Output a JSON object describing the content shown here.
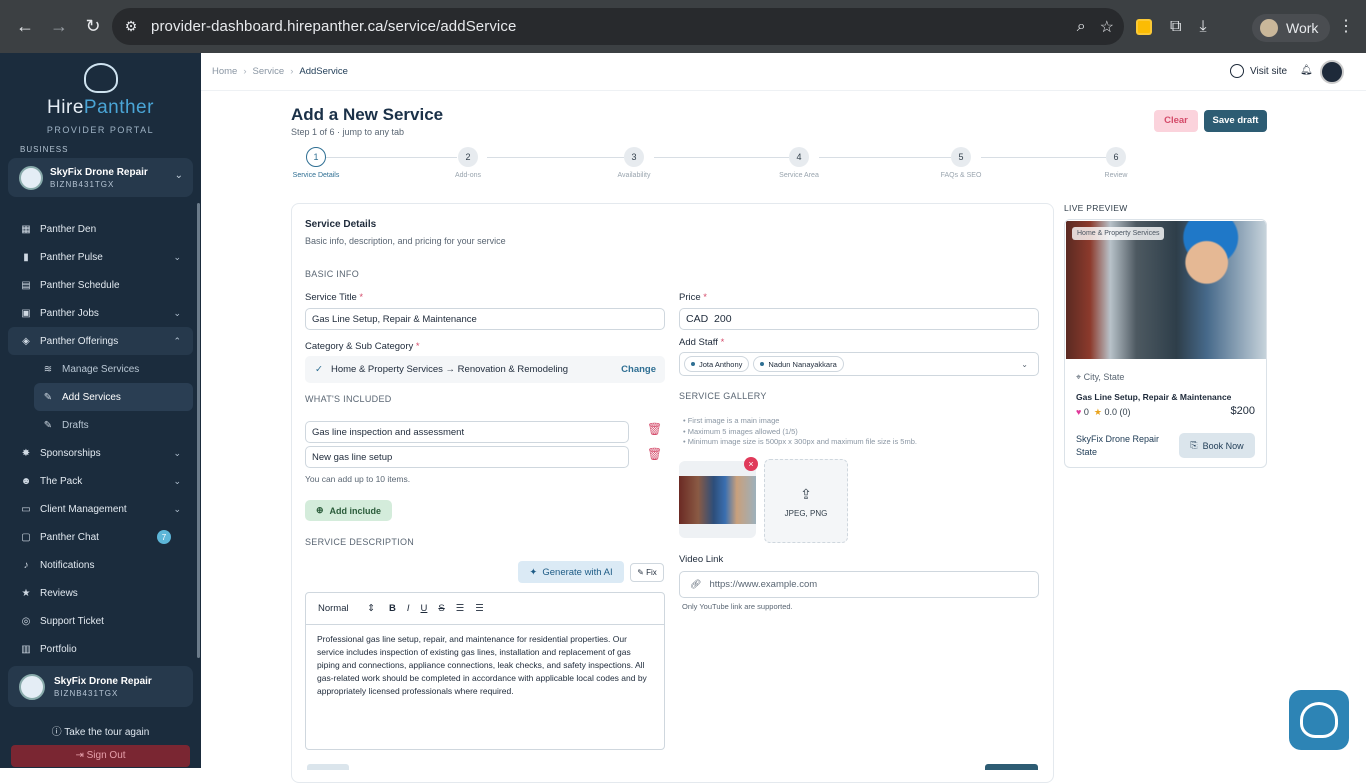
{
  "browser": {
    "url": "provider-dashboard.hirepanther.ca/service/addService",
    "profile": "Work"
  },
  "sidebar": {
    "brand_hire": "Hire",
    "brand_panther": "Panther",
    "brand_sub": "PROVIDER PORTAL",
    "section_label": "BUSINESS",
    "business": {
      "name": "SkyFix Drone Repair",
      "code": "BIZNB431TGX"
    },
    "items": [
      {
        "label": "Panther Den",
        "icon": "grid-icon",
        "chevron": false
      },
      {
        "label": "Panther Pulse",
        "icon": "bar-chart-icon",
        "chevron": true
      },
      {
        "label": "Panther Schedule",
        "icon": "calendar-icon",
        "chevron": false
      },
      {
        "label": "Panther Jobs",
        "icon": "briefcase-icon",
        "chevron": true
      },
      {
        "label": "Panther Offerings",
        "icon": "box-icon",
        "chevron": true
      },
      {
        "label": "Manage Services",
        "icon": "layers-icon"
      },
      {
        "label": "Add Services",
        "icon": "edit-icon"
      },
      {
        "label": "Drafts",
        "icon": "draft-icon"
      },
      {
        "label": "Sponsorships",
        "icon": "star-badge-icon",
        "chevron": true
      },
      {
        "label": "The Pack",
        "icon": "users-icon",
        "chevron": true
      },
      {
        "label": "Client Management",
        "icon": "id-card-icon",
        "chevron": true
      },
      {
        "label": "Panther Chat",
        "icon": "chat-icon",
        "badge": "7"
      },
      {
        "label": "Notifications",
        "icon": "bell-icon"
      },
      {
        "label": "Reviews",
        "icon": "star-icon"
      },
      {
        "label": "Support Ticket",
        "icon": "headset-icon"
      },
      {
        "label": "Portfolio",
        "icon": "portfolio-icon"
      }
    ],
    "footer_business": {
      "name": "SkyFix Drone Repair",
      "code": "BIZNB431TGX"
    },
    "tour": "Take the tour again",
    "signout": "Sign Out"
  },
  "breadcrumb": {
    "home": "Home",
    "service": "Service",
    "current": "AddService"
  },
  "topbar": {
    "visit_site": "Visit site"
  },
  "page": {
    "title": "Add a New Service",
    "step_text": "Step 1 of 6 · jump to any tab",
    "clear": "Clear",
    "save_draft": "Save draft"
  },
  "steps": [
    {
      "num": "1",
      "label": "Service Details"
    },
    {
      "num": "2",
      "label": "Add-ons"
    },
    {
      "num": "3",
      "label": "Availability"
    },
    {
      "num": "4",
      "label": "Service Area"
    },
    {
      "num": "5",
      "label": "FAQs & SEO"
    },
    {
      "num": "6",
      "label": "Review"
    }
  ],
  "form": {
    "card_title": "Service Details",
    "card_sub": "Basic info, description, and pricing for your service",
    "basic_info": "BASIC INFO",
    "service_title_label": "Service Title",
    "service_title_value": "Gas Line Setup, Repair & Maintenance",
    "price_label": "Price",
    "price_currency": "CAD",
    "price_value": "200",
    "category_label": "Category & Sub Category",
    "category_value": "Home & Property Services → Renovation & Remodeling",
    "category_change": "Change",
    "add_staff_label": "Add Staff",
    "staff": [
      "Jota Anthony",
      "Nadun Nanayakkara"
    ],
    "whats_included": "WHAT'S INCLUDED",
    "includes": [
      "Gas line inspection and assessment",
      "New gas line setup"
    ],
    "includes_hint": "You can add up to 10 items.",
    "add_include": "Add include",
    "gallery_title": "SERVICE GALLERY",
    "gallery_rules": [
      "First image is a main image",
      "Maximum 5 images allowed (1/5)",
      "Minimum image size is 500px x 300px and maximum file size is 5mb."
    ],
    "upload_types": "JPEG, PNG",
    "service_description": "SERVICE DESCRIPTION",
    "generate_ai": "Generate with AI",
    "fix": "Fix",
    "editor_format": "Normal",
    "description": "Professional gas line setup, repair, and maintenance for residential properties. Our service includes inspection of existing gas lines, installation and replacement of gas piping and connections, appliance connections, leak checks, and safety inspections. All gas-related work should be completed in accordance with applicable local codes and by appropriately licensed professionals where required.",
    "video_label": "Video Link",
    "video_placeholder": "https://www.example.com",
    "video_hint": "Only YouTube link are supported."
  },
  "preview": {
    "heading": "LIVE PREVIEW",
    "tag": "Home & Property Services",
    "location": "City, State",
    "title": "Gas Line Setup, Repair & Maintenance",
    "likes": "0",
    "rating": "0.0",
    "reviews": "(0)",
    "price": "$200",
    "business": "SkyFix Drone Repair",
    "business_state": "State",
    "book": "Book Now"
  }
}
